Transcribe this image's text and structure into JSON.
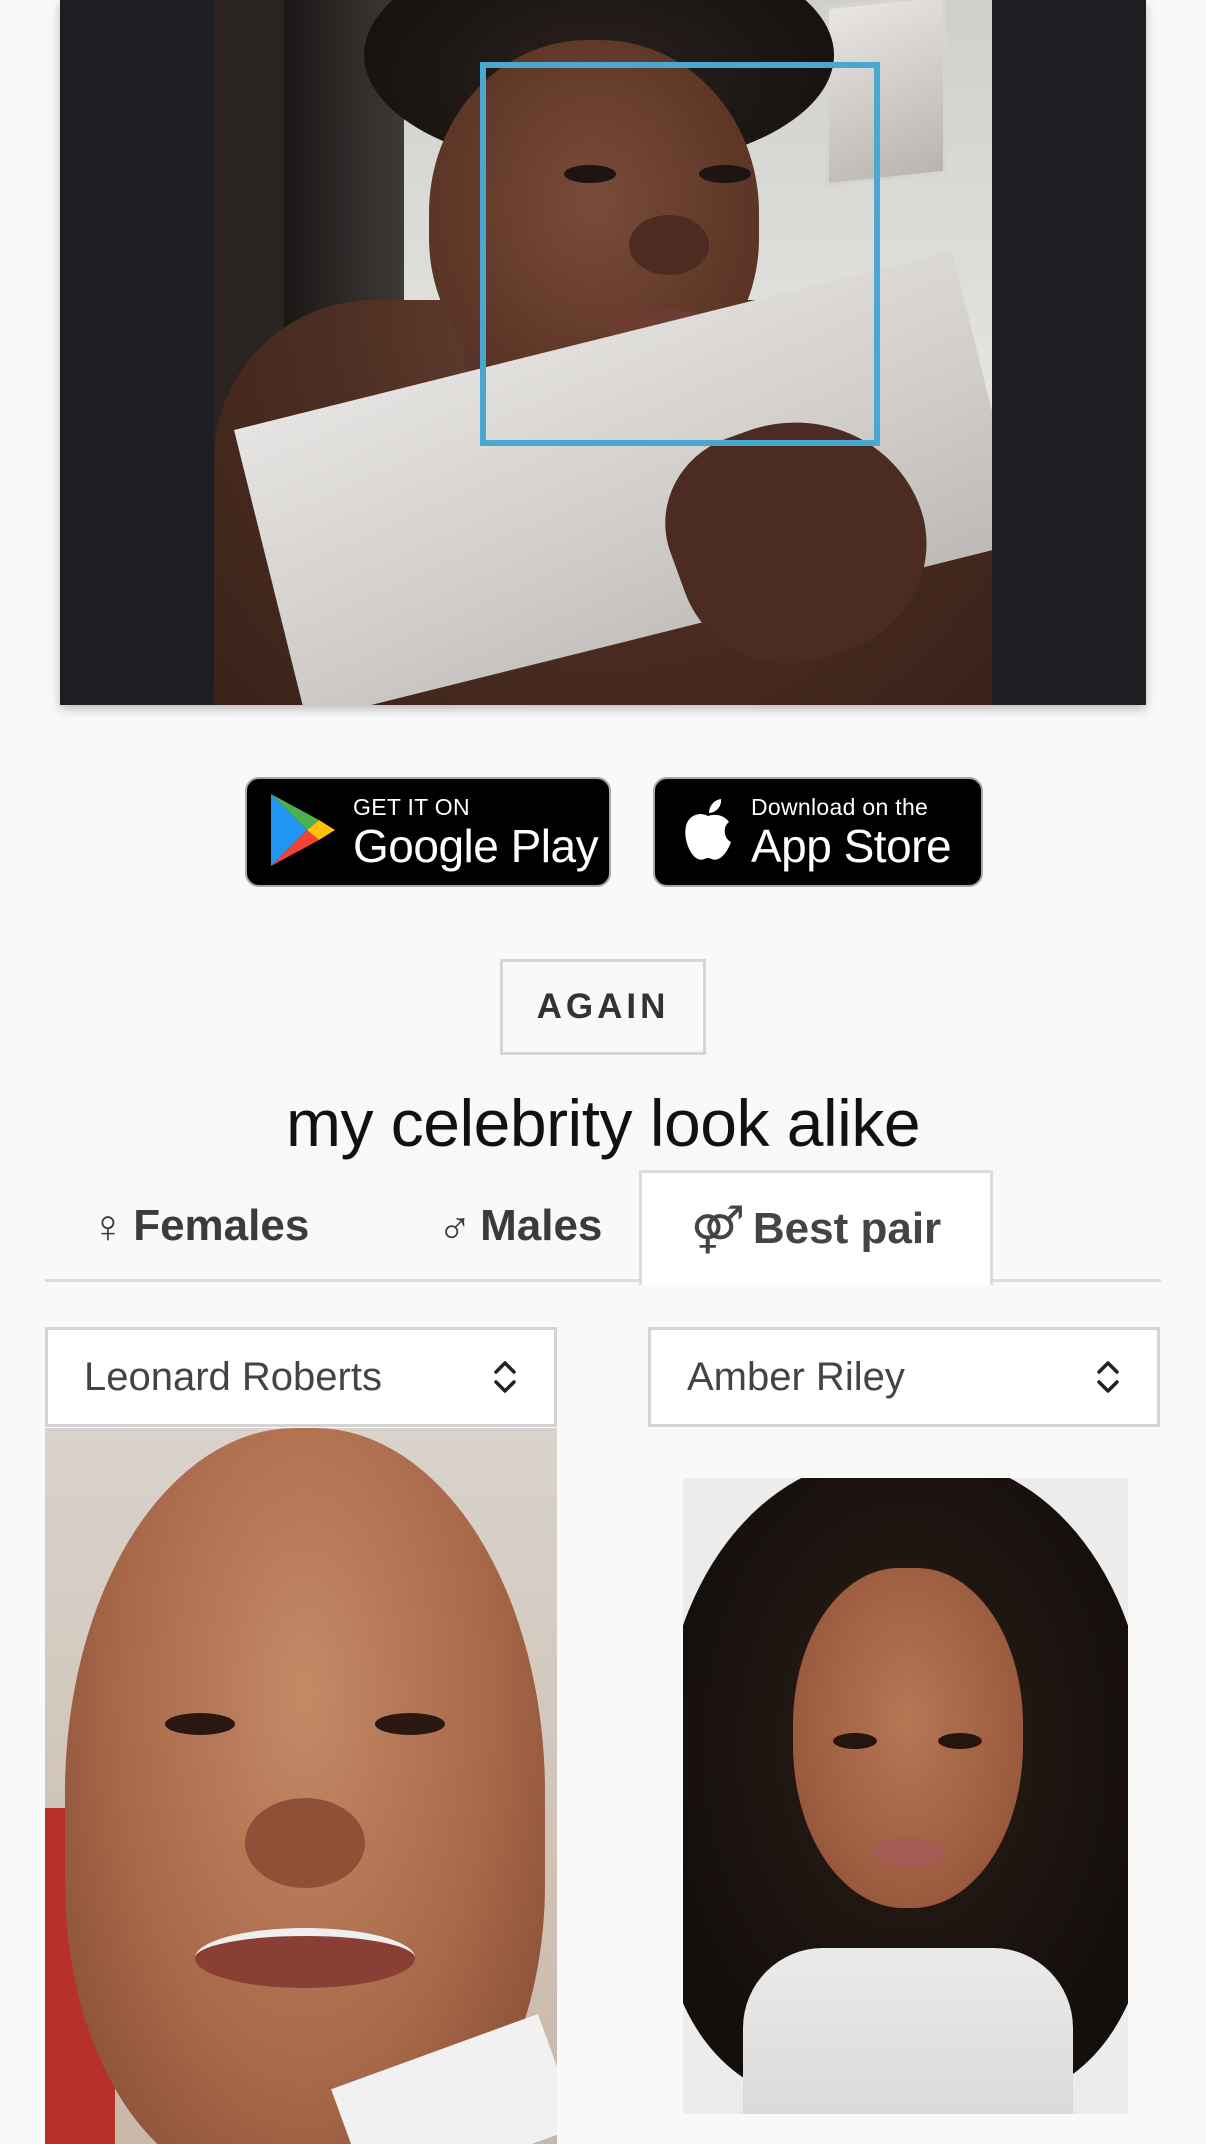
{
  "badges": {
    "google": {
      "small": "GET IT ON",
      "big": "Google Play",
      "icon": "google-play-icon"
    },
    "apple": {
      "small": "Download on the",
      "big": "App Store",
      "icon": "apple-icon"
    }
  },
  "again_label": "AGAIN",
  "title": "my celebrity look alike",
  "tabs": [
    {
      "symbol": "♀",
      "label": "Females",
      "active": false
    },
    {
      "symbol": "♂",
      "label": "Males",
      "active": false
    },
    {
      "symbol": "⚤",
      "label": "Best pair",
      "active": true
    }
  ],
  "selects": {
    "left": {
      "value": "Leonard Roberts"
    },
    "right": {
      "value": "Amber Riley"
    }
  },
  "colors": {
    "face_box": "#4aa8d0",
    "background": "#f9f9f9"
  }
}
